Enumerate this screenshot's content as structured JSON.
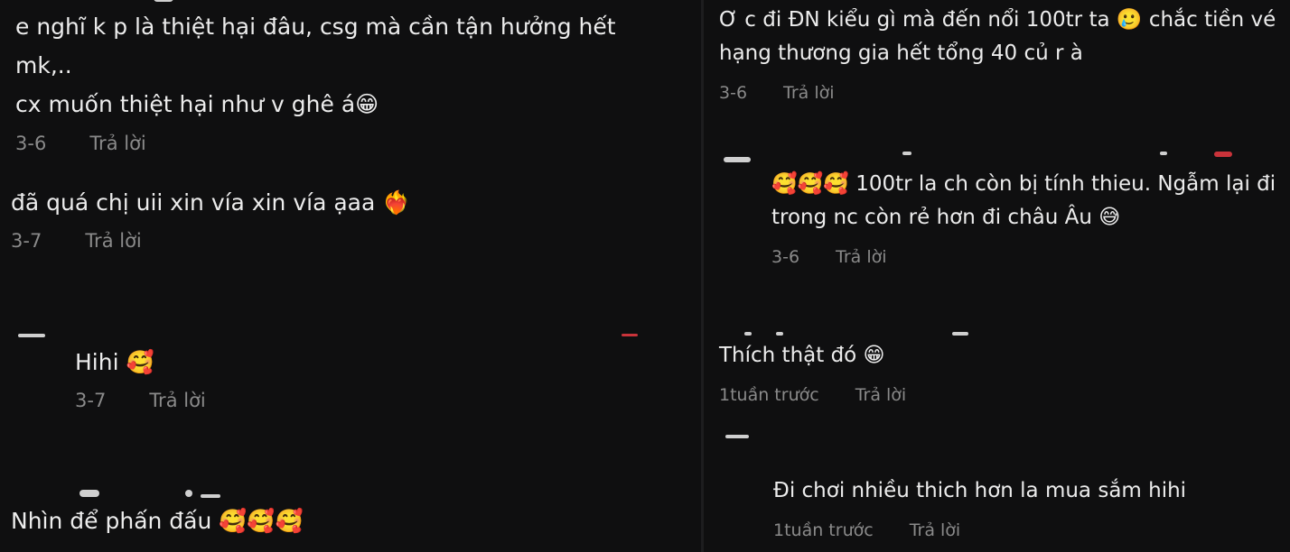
{
  "left": {
    "comments": [
      {
        "lines": [
          "e nghĩ k p là thiệt hại đâu, csg mà cần tận hưởng hết",
          "mk,..",
          "cx muốn thiệt hại như v ghê á😁"
        ],
        "date": "3-6",
        "reply": "Trả lời"
      },
      {
        "lines": [
          "đã quá chị uii xin vía xin vía ạaa ❤️‍🔥"
        ],
        "date": "3-7",
        "reply": "Trả lời"
      },
      {
        "lines": [
          "Hihi 🥰"
        ],
        "date": "3-7",
        "reply": "Trả lời"
      },
      {
        "lines": [
          "Nhìn để phấn đấu 🥰🥰🥰"
        ]
      }
    ]
  },
  "right": {
    "comments": [
      {
        "lines": [
          "Ơ c đi ĐN kiểu gì mà đến nổi 100tr ta 🥲 chắc tiền vé",
          "hạng thương gia hết tổng 40 củ r à"
        ],
        "date": "3-6",
        "reply": "Trả lời"
      },
      {
        "lines": [
          "🥰🥰🥰 100tr la ch còn bị tính thieu. Ngẫm lại đi",
          "trong nc còn rẻ hơn đi châu Âu 😅"
        ],
        "date": "3-6",
        "reply": "Trả lời"
      },
      {
        "lines": [
          "Thích thật đó 😁"
        ],
        "date": "1tuần trước",
        "reply": "Trả lời"
      },
      {
        "lines": [
          "Đi chơi nhiều thich hơn la mua sắm hihi"
        ],
        "date": "1tuần trước",
        "reply": "Trả lời"
      }
    ]
  }
}
